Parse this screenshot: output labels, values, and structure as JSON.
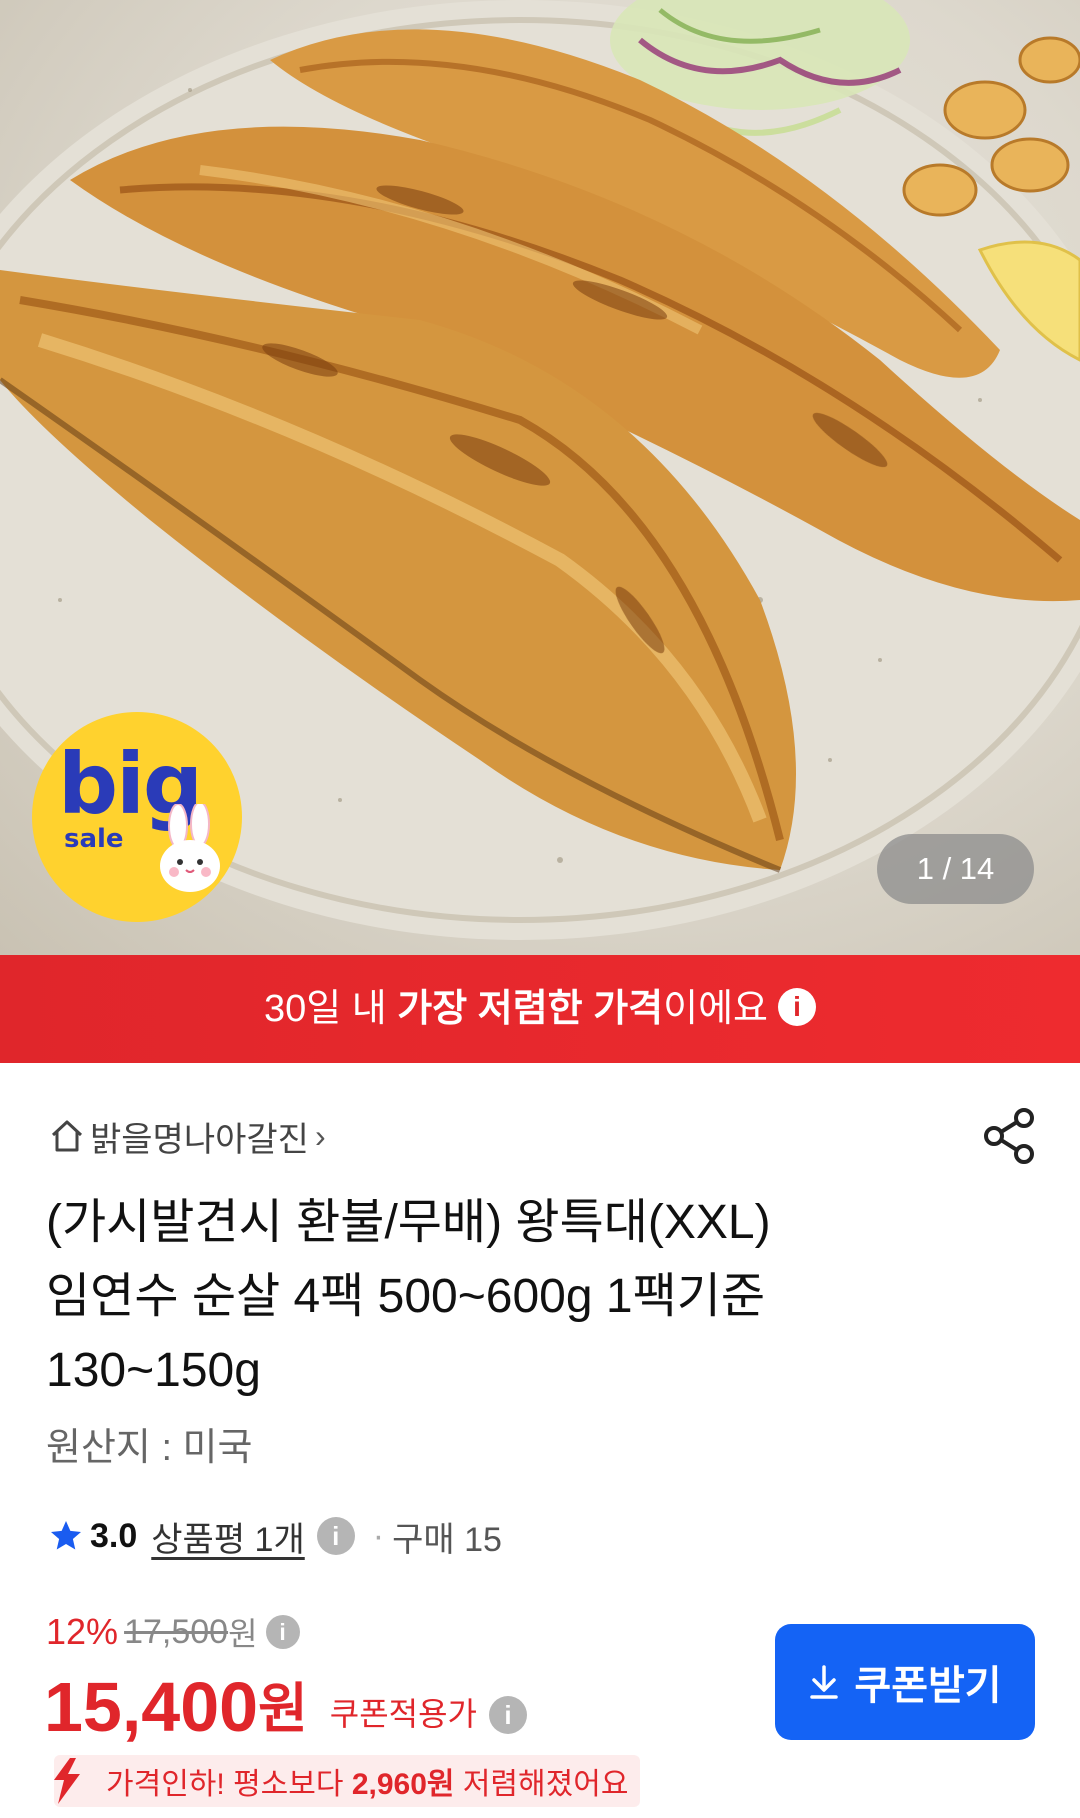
{
  "hero": {
    "badge_big": "big",
    "badge_sale": "sale",
    "counter": "1 / 14"
  },
  "banner": {
    "prefix": "30일 내 ",
    "bold": "가장 저렴한 가격",
    "suffix": "이에요",
    "info_icon": "i"
  },
  "store": {
    "name": "밝을명나아갈진",
    "chevron": "›"
  },
  "product": {
    "title_lines": [
      "(가시발견시 환불/무배) 왕특대(XXL)",
      "임연수 순살 4팩 500~600g 1팩기준",
      "130~150g"
    ],
    "origin": "원산지 : 미국"
  },
  "rating": {
    "score": "3.0",
    "reviews": "상품평 1개",
    "separator": "·",
    "purchases": "구매 15"
  },
  "pricing": {
    "discount_pct": "12%",
    "original_price": "17,500",
    "original_unit": "원",
    "price": "15,400",
    "price_unit": "원",
    "coupon_label": "쿠폰적용가",
    "info_icon": "i"
  },
  "coupon_button": {
    "label": "쿠폰받기"
  },
  "price_drop": {
    "prefix": "가격인하! 평소보다 ",
    "amount": "2,960원",
    "suffix": " 저렴해졌어요"
  },
  "colors": {
    "accent_red": "#e0262b",
    "button_blue": "#1463f5",
    "badge_yellow": "#ffd22e"
  },
  "icons": [
    "home-icon",
    "chevron-right-icon",
    "share-icon",
    "star-icon",
    "info-icon",
    "download-icon",
    "arrow-down-icon",
    "bunny-icon"
  ]
}
